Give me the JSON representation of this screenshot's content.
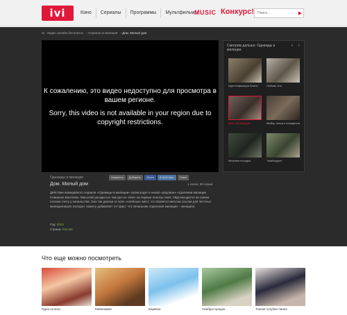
{
  "header": {
    "logo": "ivi",
    "nav": [
      "Кино",
      "Сериалы",
      "Программы",
      "Мультфильмы"
    ],
    "music": "MUSIC",
    "konkurs": "Конкурс!",
    "search_placeholder": "Поиск..."
  },
  "breadcrumb": [
    "ivi - видео онлайн бесплатно",
    "Сериалы в милиции",
    "Дом. Милый дом"
  ],
  "player": {
    "message_ru": "К сожалению, это видео недоступно для просмотра в вашем регионе.",
    "message_en": "Sorry, this video is not available in your region due to copyright restrictions."
  },
  "info": {
    "series": "Однажды в милиции",
    "title": "Дом. Милый дом",
    "share": [
      "Нравится",
      "Добавить",
      "Share",
      "В Мой Мир",
      "Tweet"
    ],
    "season": "1 сезон, 80 серия",
    "description": "Действие комедийного сериала «Однажды в милиции» происходит в некой «рядовом» отделении милиции Северное Бахтеево. Масштаб раскрытых там дел не тянет на первые полосы газет, УВД находится на самом плохом счету у начальства. Оно так далека от всех «хлебных» мест, что является местом ссылки для честных милиционеров. Колорит сюжету добавляет тот факт, что начальник отделения милиции – женщина",
    "year_label": "Год:",
    "year": "2010",
    "country_label": "Страна:",
    "country": "Россия"
  },
  "sidebar": {
    "header": "Смотрим дальше: Однажды в милиции",
    "arrows": "‹ ›",
    "items": [
      {
        "caption": "Идентификация Блиса"
      },
      {
        "caption": "Любовь зла"
      },
      {
        "caption": "Дом. Милый дом",
        "active": true
      },
      {
        "caption": "Майор легкого поведения"
      },
      {
        "caption": "Мертвая посадка"
      },
      {
        "caption": "Тимбилдинг"
      }
    ]
  },
  "more": {
    "title": "Что еще можно посмотреть",
    "items": [
      "Одна за всех",
      "Мовенжики",
      "Барвиха",
      "Свибра-городок",
      "Тонкая голубая линия"
    ]
  },
  "colors": {
    "brand": "#e0183a",
    "dark_bg": "#2b2b2b",
    "meta_value": "#8ab34a"
  }
}
